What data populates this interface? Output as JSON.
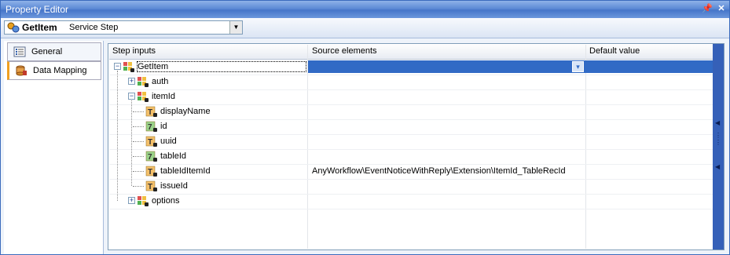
{
  "window": {
    "title": "Property Editor",
    "pin_glyph": "📌",
    "close_glyph": "✕"
  },
  "toolbar": {
    "selected_name": "GetItem",
    "selected_type": "Service Step",
    "arrow_glyph": "▼"
  },
  "sidebar": {
    "items": [
      {
        "label": "General"
      },
      {
        "label": "Data Mapping"
      }
    ]
  },
  "grid": {
    "columns": [
      "Step inputs",
      "Source elements",
      "Default value"
    ],
    "rows": [
      {
        "name": "GetItem",
        "source": "",
        "icon": "struct-icon",
        "expander": "−",
        "depth": 0
      },
      {
        "name": "auth",
        "source": "",
        "icon": "struct-icon",
        "expander": "+",
        "depth": 1
      },
      {
        "name": "itemId",
        "source": "",
        "icon": "struct-icon",
        "expander": "−",
        "depth": 1
      },
      {
        "name": "displayName",
        "source": "",
        "icon": "text-icon",
        "expander": "",
        "depth": 2
      },
      {
        "name": "id",
        "source": "",
        "icon": "number-icon",
        "expander": "",
        "depth": 2
      },
      {
        "name": "uuid",
        "source": "",
        "icon": "text-icon",
        "expander": "",
        "depth": 2
      },
      {
        "name": "tableId",
        "source": "",
        "icon": "number-icon",
        "expander": "",
        "depth": 2
      },
      {
        "name": "tableIdItemId",
        "source": "AnyWorkflow\\EventNoticeWithReply\\Extension\\ItemId_TableRecId",
        "icon": "text-icon",
        "expander": "",
        "depth": 2
      },
      {
        "name": "issueId",
        "source": "",
        "icon": "text-icon",
        "expander": "",
        "depth": 2
      },
      {
        "name": "options",
        "source": "",
        "icon": "struct-icon",
        "expander": "+",
        "depth": 1
      }
    ],
    "text_icon_glyph": "T",
    "number_icon_glyph": "7",
    "dropdown_glyph": "▾"
  },
  "colors": {
    "selection": "#316ac5",
    "title_bar": "#4676c9"
  }
}
